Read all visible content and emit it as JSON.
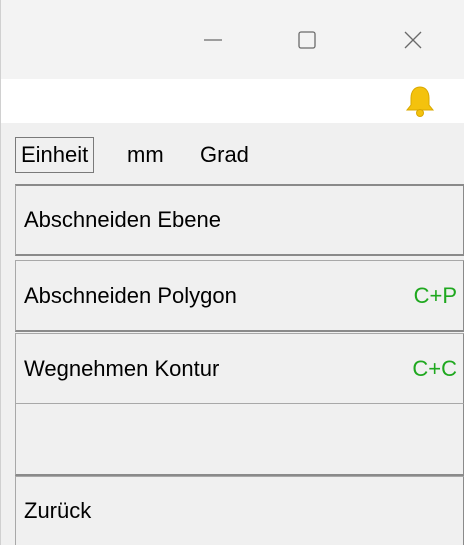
{
  "window": {
    "controls": {
      "minimize_icon": "minimize-icon",
      "maximize_icon": "maximize-icon",
      "close_icon": "close-icon"
    },
    "notification_icon": "bell-icon",
    "notification_color": "#f4c20d"
  },
  "unit_bar": {
    "button_label": "Einheit",
    "length_unit": "mm",
    "angle_unit": "Grad"
  },
  "menu": {
    "items": [
      {
        "label": "Abschneiden Ebene",
        "shortcut": ""
      },
      {
        "label": "Abschneiden Polygon",
        "shortcut": "C+P"
      },
      {
        "label": "Wegnehmen Kontur",
        "shortcut": "C+C"
      },
      {
        "label": "",
        "shortcut": ""
      },
      {
        "label": "Zurück",
        "shortcut": ""
      }
    ],
    "shortcut_color": "#1fa81f"
  }
}
